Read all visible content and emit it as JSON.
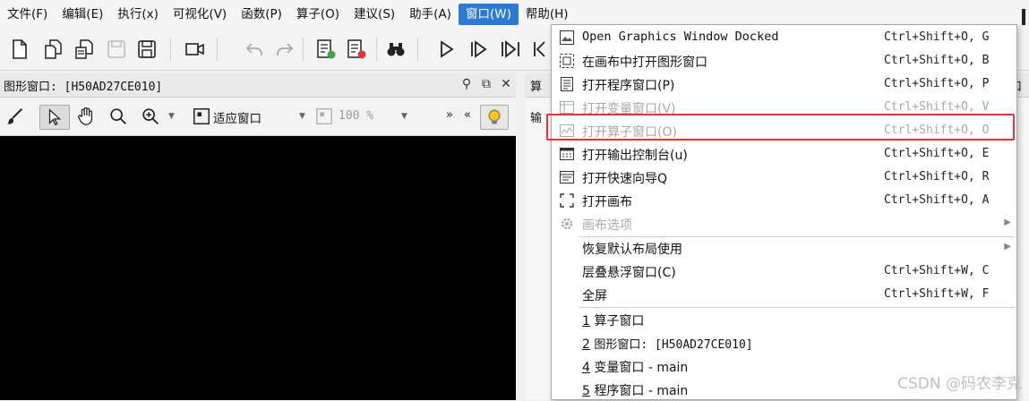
{
  "menubar": {
    "items": [
      {
        "label": "文件(F)"
      },
      {
        "label": "编辑(E)"
      },
      {
        "label": "执行(x)"
      },
      {
        "label": "可视化(V)"
      },
      {
        "label": "函数(P)"
      },
      {
        "label": "算子(O)"
      },
      {
        "label": "建议(S)"
      },
      {
        "label": "助手(A)"
      },
      {
        "label": "窗口(W)",
        "active": true
      },
      {
        "label": "帮助(H)"
      }
    ]
  },
  "graphics_window": {
    "title": "图形窗口: [H50AD27CE010]",
    "fit_label": "适应窗口",
    "zoom_label": "100 %"
  },
  "operator_panel": {
    "title_fragment": "算",
    "input_fragment": "输",
    "right_fragment": "口"
  },
  "window_menu": {
    "items": [
      {
        "label": "Open Graphics Window Docked",
        "shortcut": "Ctrl+Shift+O, G",
        "icon": "graphics-window-icon",
        "disabled": false
      },
      {
        "label": "在画布中打开图形窗口",
        "shortcut": "Ctrl+Shift+O, B",
        "icon": "canvas-graphics-icon",
        "disabled": false
      },
      {
        "label": "打开程序窗口(P)",
        "shortcut": "Ctrl+Shift+O, P",
        "icon": "program-window-icon",
        "disabled": false
      },
      {
        "label": "打开变量窗口(V)",
        "shortcut": "Ctrl+Shift+O, V",
        "icon": "variable-window-icon",
        "disabled": true
      },
      {
        "label": "打开算子窗口(O)",
        "shortcut": "Ctrl+Shift+O, O",
        "icon": "operator-window-icon",
        "disabled": true
      },
      {
        "label": "打开输出控制台(u)",
        "shortcut": "Ctrl+Shift+O, E",
        "icon": "console-icon",
        "disabled": false
      },
      {
        "label": "打开快速向导Q",
        "shortcut": "Ctrl+Shift+O, R",
        "icon": "quick-guide-icon",
        "disabled": false
      },
      {
        "label": "打开画布",
        "shortcut": "Ctrl+Shift+O, A",
        "icon": "canvas-icon",
        "disabled": false
      },
      {
        "label": "画布选项",
        "shortcut": "",
        "icon": "gear-icon",
        "disabled": true,
        "submenu": true
      }
    ],
    "layout_items": [
      {
        "label": "恢复默认布局使用",
        "shortcut": "",
        "submenu": true
      },
      {
        "label": "层叠悬浮窗口(C)",
        "shortcut": "Ctrl+Shift+W, C"
      },
      {
        "label": "全屏",
        "shortcut": "Ctrl+Shift+W, F"
      }
    ],
    "open_windows": [
      {
        "num": "1",
        "label": "算子窗口"
      },
      {
        "num": "2",
        "label": "图形窗口: [H50AD27CE010]"
      },
      {
        "num": "4",
        "label": "变量窗口 - main"
      },
      {
        "num": "5",
        "label": "程序窗口 - main"
      }
    ]
  },
  "watermark": "CSDN @码农李克"
}
